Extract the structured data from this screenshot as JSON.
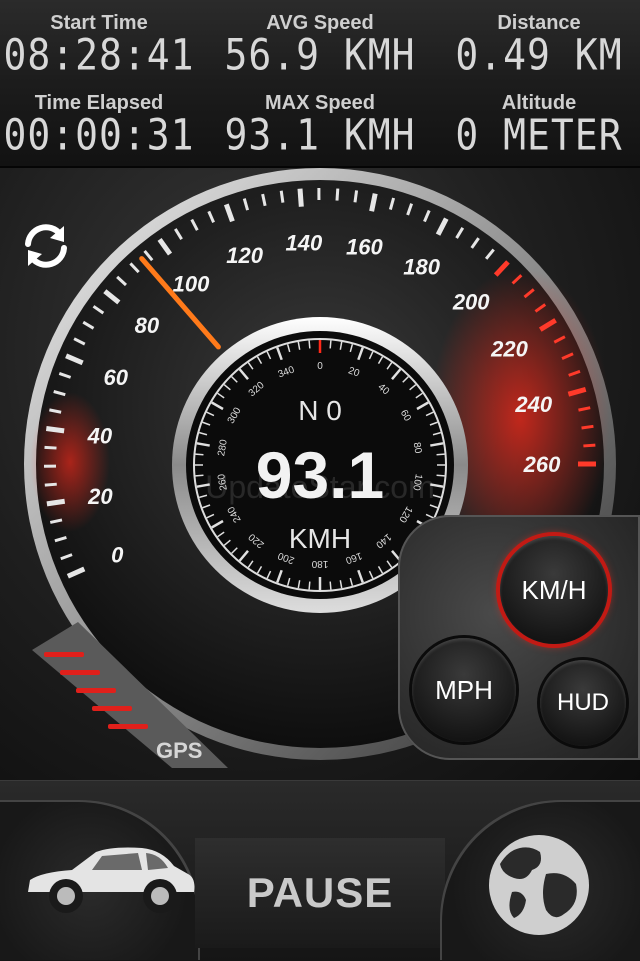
{
  "stats": {
    "start_time": {
      "label": "Start Time",
      "value": "08:28:41"
    },
    "avg_speed": {
      "label": "AVG Speed",
      "value": "56.9 KMH"
    },
    "distance": {
      "label": "Distance",
      "value": "0.49 KM"
    },
    "time_elapsed": {
      "label": "Time Elapsed",
      "value": "00:00:31"
    },
    "max_speed": {
      "label": "MAX Speed",
      "value": "93.1 KMH"
    },
    "altitude": {
      "label": "Altitude",
      "value": "0 METER"
    }
  },
  "speedometer": {
    "ticks": [
      "0",
      "20",
      "40",
      "60",
      "80",
      "100",
      "120",
      "140",
      "160",
      "180",
      "200",
      "220",
      "240",
      "260"
    ],
    "needle_value": 93.1,
    "max_value": 260
  },
  "compass": {
    "heading_label": "N 0",
    "speed": "93.1",
    "unit": "KMH",
    "ticks": [
      "0",
      "20",
      "40",
      "60",
      "80",
      "100",
      "120",
      "140",
      "160",
      "180",
      "200",
      "220",
      "240",
      "260",
      "280",
      "300",
      "320",
      "340"
    ]
  },
  "gps": {
    "label": "GPS"
  },
  "units": {
    "kmh": "KM/H",
    "mph": "MPH",
    "hud": "HUD"
  },
  "controls": {
    "pause": "PAUSE"
  },
  "watermark": "UpdateStar.com",
  "colors": {
    "accent_red": "#e0201b",
    "text_light": "#d8d8d8"
  }
}
